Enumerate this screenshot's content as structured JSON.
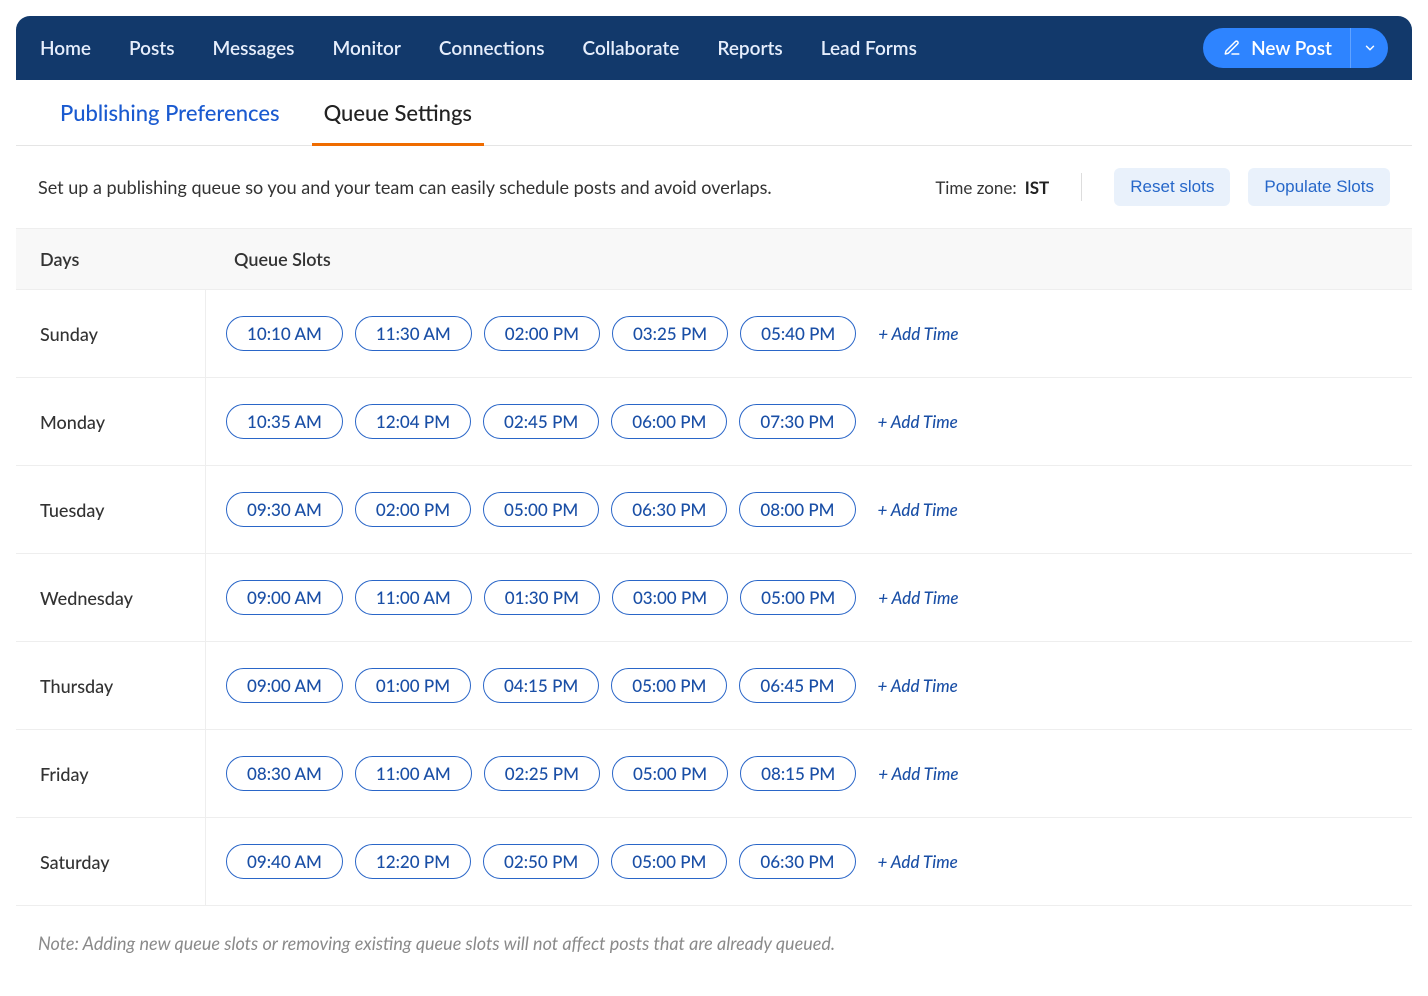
{
  "nav": {
    "items": [
      "Home",
      "Posts",
      "Messages",
      "Monitor",
      "Connections",
      "Collaborate",
      "Reports",
      "Lead Forms"
    ],
    "newPostLabel": "New Post"
  },
  "tabs": {
    "publishing": "Publishing Preferences",
    "queue": "Queue Settings"
  },
  "description": "Set up a publishing queue so you and your team can easily schedule posts and avoid overlaps.",
  "timezone": {
    "label": "Time zone:",
    "value": "IST"
  },
  "actions": {
    "reset": "Reset slots",
    "populate": "Populate Slots"
  },
  "tableHeader": {
    "days": "Days",
    "slots": "Queue Slots"
  },
  "addTimeLabel": "+ Add Time",
  "days": [
    {
      "name": "Sunday",
      "slots": [
        "10:10 AM",
        "11:30 AM",
        "02:00 PM",
        "03:25 PM",
        "05:40 PM"
      ]
    },
    {
      "name": "Monday",
      "slots": [
        "10:35 AM",
        "12:04 PM",
        "02:45 PM",
        "06:00 PM",
        "07:30 PM"
      ]
    },
    {
      "name": "Tuesday",
      "slots": [
        "09:30 AM",
        "02:00 PM",
        "05:00 PM",
        "06:30 PM",
        "08:00 PM"
      ]
    },
    {
      "name": "Wednesday",
      "slots": [
        "09:00 AM",
        "11:00 AM",
        "01:30 PM",
        "03:00 PM",
        "05:00 PM"
      ]
    },
    {
      "name": "Thursday",
      "slots": [
        "09:00 AM",
        "01:00 PM",
        "04:15 PM",
        "05:00 PM",
        "06:45 PM"
      ]
    },
    {
      "name": "Friday",
      "slots": [
        "08:30 AM",
        "11:00 AM",
        "02:25 PM",
        "05:00 PM",
        "08:15 PM"
      ]
    },
    {
      "name": "Saturday",
      "slots": [
        "09:40 AM",
        "12:20 PM",
        "02:50 PM",
        "05:00 PM",
        "06:30 PM"
      ]
    }
  ],
  "note": "Note: Adding new queue slots or removing existing queue slots will not affect posts that are already queued."
}
